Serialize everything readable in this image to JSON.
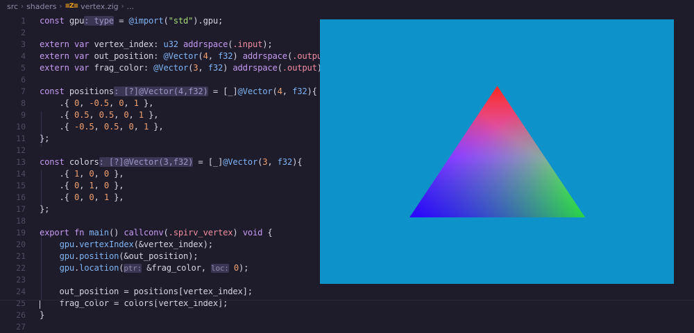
{
  "breadcrumb": {
    "items": [
      "src",
      "shaders",
      "vertex.zig",
      "..."
    ],
    "zig_icon": "zig-logo-icon"
  },
  "editor": {
    "lines": [
      {
        "n": "1",
        "parts": [
          [
            "kw",
            "const "
          ],
          [
            "var",
            "gpu"
          ],
          [
            "hint",
            ": type"
          ],
          [
            "var",
            " = "
          ],
          [
            "fn",
            "@import"
          ],
          [
            "var",
            "("
          ],
          [
            "str",
            "\"std\""
          ],
          [
            "var",
            ")."
          ],
          [
            "var",
            "gpu"
          ],
          [
            "var",
            ";"
          ]
        ]
      },
      {
        "n": "2",
        "parts": []
      },
      {
        "n": "3",
        "parts": [
          [
            "kw",
            "extern var "
          ],
          [
            "var",
            "vertex_index"
          ],
          [
            "var",
            ": "
          ],
          [
            "ty",
            "u32 "
          ],
          [
            "kw",
            "addrspace"
          ],
          [
            "var",
            "("
          ],
          [
            "en",
            ".input"
          ],
          [
            "var",
            ");"
          ]
        ]
      },
      {
        "n": "4",
        "parts": [
          [
            "kw",
            "extern var "
          ],
          [
            "var",
            "out_position"
          ],
          [
            "var",
            ": "
          ],
          [
            "fn",
            "@Vector"
          ],
          [
            "var",
            "("
          ],
          [
            "num",
            "4"
          ],
          [
            "var",
            ", "
          ],
          [
            "ty",
            "f32"
          ],
          [
            "var",
            ") "
          ],
          [
            "kw",
            "addrspace"
          ],
          [
            "var",
            "("
          ],
          [
            "en",
            ".output"
          ],
          [
            "var",
            ");"
          ]
        ]
      },
      {
        "n": "5",
        "parts": [
          [
            "kw",
            "extern var "
          ],
          [
            "var",
            "frag_color"
          ],
          [
            "var",
            ": "
          ],
          [
            "fn",
            "@Vector"
          ],
          [
            "var",
            "("
          ],
          [
            "num",
            "3"
          ],
          [
            "var",
            ", "
          ],
          [
            "ty",
            "f32"
          ],
          [
            "var",
            ") "
          ],
          [
            "kw",
            "addrspace"
          ],
          [
            "var",
            "("
          ],
          [
            "en",
            ".output"
          ],
          [
            "var",
            ");"
          ]
        ]
      },
      {
        "n": "6",
        "parts": []
      },
      {
        "n": "7",
        "parts": [
          [
            "kw",
            "const "
          ],
          [
            "var",
            "positions"
          ],
          [
            "hint",
            ": [?]@Vector(4,f32)"
          ],
          [
            "var",
            " = ["
          ],
          [
            "var",
            "_"
          ],
          [
            "var",
            "]"
          ],
          [
            "fn",
            "@Vector"
          ],
          [
            "var",
            "("
          ],
          [
            "num",
            "4"
          ],
          [
            "var",
            ", "
          ],
          [
            "ty",
            "f32"
          ],
          [
            "var",
            ")"
          ],
          [
            "var",
            "{"
          ]
        ]
      },
      {
        "n": "8",
        "parts": [
          [
            "var",
            "    .{ "
          ],
          [
            "num",
            "0"
          ],
          [
            "var",
            ", "
          ],
          [
            "num",
            "-0.5"
          ],
          [
            "var",
            ", "
          ],
          [
            "num",
            "0"
          ],
          [
            "var",
            ", "
          ],
          [
            "num",
            "1"
          ],
          [
            "var",
            " },"
          ]
        ]
      },
      {
        "n": "9",
        "parts": [
          [
            "var",
            "    .{ "
          ],
          [
            "num",
            "0.5"
          ],
          [
            "var",
            ", "
          ],
          [
            "num",
            "0.5"
          ],
          [
            "var",
            ", "
          ],
          [
            "num",
            "0"
          ],
          [
            "var",
            ", "
          ],
          [
            "num",
            "1"
          ],
          [
            "var",
            " },"
          ]
        ]
      },
      {
        "n": "10",
        "parts": [
          [
            "var",
            "    .{ "
          ],
          [
            "num",
            "-0.5"
          ],
          [
            "var",
            ", "
          ],
          [
            "num",
            "0.5"
          ],
          [
            "var",
            ", "
          ],
          [
            "num",
            "0"
          ],
          [
            "var",
            ", "
          ],
          [
            "num",
            "1"
          ],
          [
            "var",
            " },"
          ]
        ]
      },
      {
        "n": "11",
        "parts": [
          [
            "var",
            "};"
          ]
        ]
      },
      {
        "n": "12",
        "parts": []
      },
      {
        "n": "13",
        "parts": [
          [
            "kw",
            "const "
          ],
          [
            "var",
            "colors"
          ],
          [
            "hint",
            ": [?]@Vector(3,f32)"
          ],
          [
            "var",
            " = ["
          ],
          [
            "var",
            "_"
          ],
          [
            "var",
            "]"
          ],
          [
            "fn",
            "@Vector"
          ],
          [
            "var",
            "("
          ],
          [
            "num",
            "3"
          ],
          [
            "var",
            ", "
          ],
          [
            "ty",
            "f32"
          ],
          [
            "var",
            ")"
          ],
          [
            "var",
            "{"
          ]
        ]
      },
      {
        "n": "14",
        "parts": [
          [
            "var",
            "    .{ "
          ],
          [
            "num",
            "1"
          ],
          [
            "var",
            ", "
          ],
          [
            "num",
            "0"
          ],
          [
            "var",
            ", "
          ],
          [
            "num",
            "0"
          ],
          [
            "var",
            " },"
          ]
        ]
      },
      {
        "n": "15",
        "parts": [
          [
            "var",
            "    .{ "
          ],
          [
            "num",
            "0"
          ],
          [
            "var",
            ", "
          ],
          [
            "num",
            "1"
          ],
          [
            "var",
            ", "
          ],
          [
            "num",
            "0"
          ],
          [
            "var",
            " },"
          ]
        ]
      },
      {
        "n": "16",
        "parts": [
          [
            "var",
            "    .{ "
          ],
          [
            "num",
            "0"
          ],
          [
            "var",
            ", "
          ],
          [
            "num",
            "0"
          ],
          [
            "var",
            ", "
          ],
          [
            "num",
            "1"
          ],
          [
            "var",
            " },"
          ]
        ]
      },
      {
        "n": "17",
        "parts": [
          [
            "var",
            "};"
          ]
        ]
      },
      {
        "n": "18",
        "parts": []
      },
      {
        "n": "19",
        "parts": [
          [
            "kw",
            "export fn "
          ],
          [
            "fn",
            "main"
          ],
          [
            "var",
            "() "
          ],
          [
            "kw",
            "callconv"
          ],
          [
            "var",
            "("
          ],
          [
            "en",
            ".spirv_vertex"
          ],
          [
            "var",
            ") "
          ],
          [
            "kw",
            "void"
          ],
          [
            "var",
            " {"
          ]
        ]
      },
      {
        "n": "20",
        "parts": [
          [
            "var",
            "    "
          ],
          [
            "fn",
            "gpu"
          ],
          [
            "var",
            "."
          ],
          [
            "fn",
            "vertexIndex"
          ],
          [
            "var",
            "(&"
          ],
          [
            "var",
            "vertex_index"
          ],
          [
            "var",
            ");"
          ]
        ]
      },
      {
        "n": "21",
        "parts": [
          [
            "var",
            "    "
          ],
          [
            "fn",
            "gpu"
          ],
          [
            "var",
            "."
          ],
          [
            "fn",
            "position"
          ],
          [
            "var",
            "(&"
          ],
          [
            "var",
            "out_position"
          ],
          [
            "var",
            ");"
          ]
        ]
      },
      {
        "n": "22",
        "parts": [
          [
            "var",
            "    "
          ],
          [
            "fn",
            "gpu"
          ],
          [
            "var",
            "."
          ],
          [
            "fn",
            "location"
          ],
          [
            "var",
            "("
          ],
          [
            "hint2",
            "ptr:"
          ],
          [
            "var",
            " &"
          ],
          [
            "var",
            "frag_color"
          ],
          [
            "var",
            ", "
          ],
          [
            "hint2",
            "loc:"
          ],
          [
            "var",
            " "
          ],
          [
            "num",
            "0"
          ],
          [
            "var",
            ");"
          ]
        ]
      },
      {
        "n": "23",
        "parts": []
      },
      {
        "n": "24",
        "parts": [
          [
            "var",
            "    out_position = positions["
          ],
          [
            "var",
            "vertex_index"
          ],
          [
            "var",
            "];"
          ]
        ]
      },
      {
        "n": "25",
        "parts": [
          [
            "var",
            "    frag_color = colors["
          ],
          [
            "var",
            "vertex_index"
          ],
          [
            "var",
            "];"
          ]
        ]
      },
      {
        "n": "26",
        "parts": [
          [
            "var",
            "}"
          ]
        ]
      },
      {
        "n": "27",
        "parts": []
      }
    ]
  },
  "preview": {
    "background": "#0d93c9",
    "vertex_colors": [
      "#ff0000",
      "#00ff00",
      "#0000ff"
    ]
  }
}
